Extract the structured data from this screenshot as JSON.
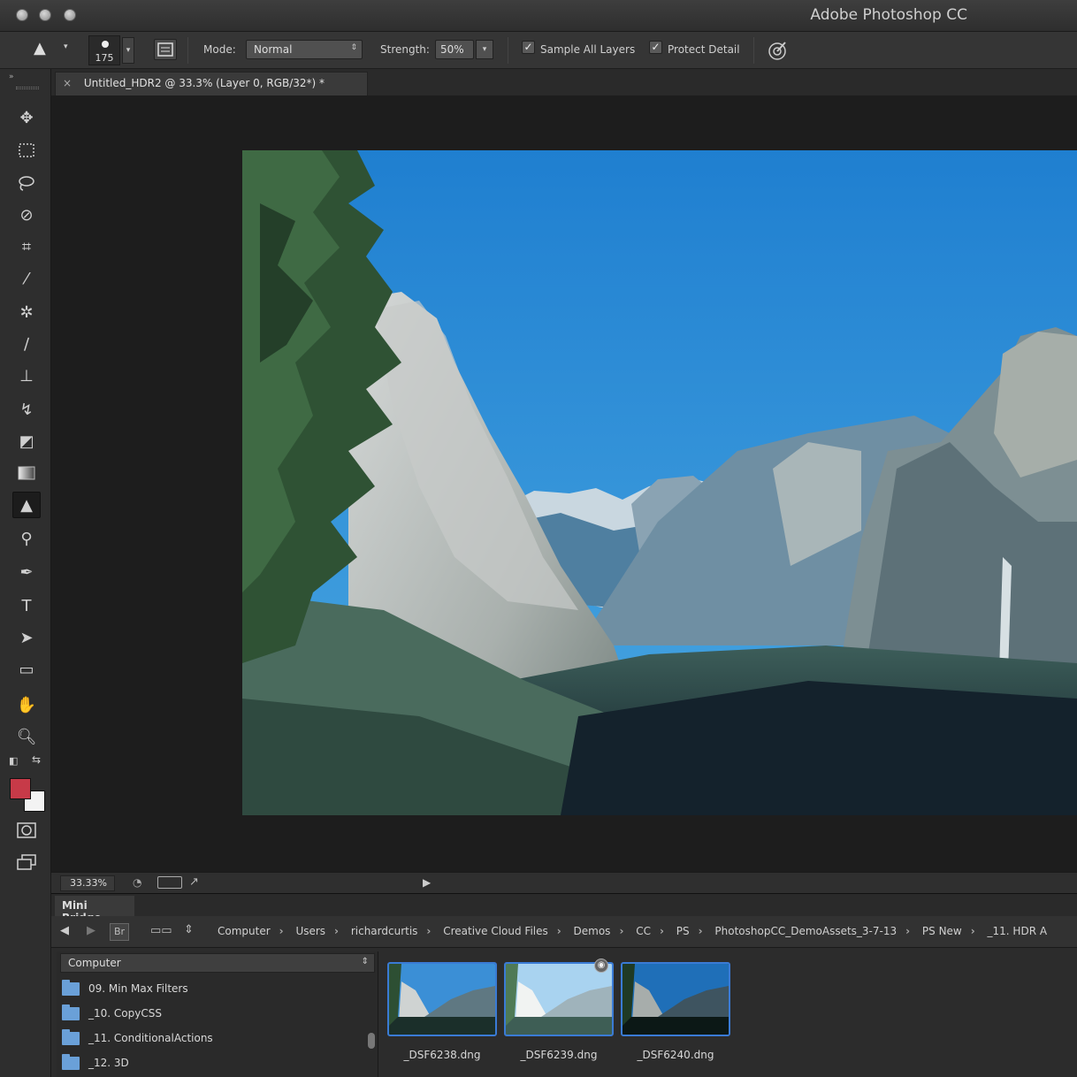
{
  "window": {
    "title": "Adobe Photoshop CC"
  },
  "options_bar": {
    "brush_size": "175",
    "mode_label": "Mode:",
    "mode_value": "Normal",
    "strength_label": "Strength:",
    "strength_value": "50%",
    "sample_all_layers_label": "Sample All Layers",
    "sample_all_layers_checked": true,
    "protect_detail_label": "Protect Detail",
    "protect_detail_checked": true
  },
  "document": {
    "tab_title": "Untitled_HDR2 @ 33.3% (Layer 0, RGB/32*) *",
    "zoom": "33.33%"
  },
  "colors": {
    "foreground": "#c73a48",
    "background": "#f3f3f3",
    "accent": "#3a7bd5"
  },
  "tools": [
    "move-tool-icon",
    "marquee-tool-icon",
    "lasso-tool-icon",
    "quick-selection-tool-icon",
    "crop-tool-icon",
    "eyedropper-tool-icon",
    "spot-healing-tool-icon",
    "brush-tool-icon",
    "clone-stamp-tool-icon",
    "history-brush-tool-icon",
    "eraser-tool-icon",
    "gradient-tool-icon",
    "sharpen-tool-icon",
    "dodge-tool-icon",
    "pen-tool-icon",
    "type-tool-icon",
    "path-selection-tool-icon",
    "rectangle-tool-icon",
    "hand-tool-icon",
    "zoom-tool-icon"
  ],
  "mini_bridge": {
    "title": "Mini Bridge",
    "bridge_button": "Br",
    "breadcrumbs": [
      "Computer",
      "Users",
      "richardcurtis",
      "Creative Cloud Files",
      "Demos",
      "CC",
      "PS",
      "PhotoshopCC_DemoAssets_3-7-13",
      "PS New",
      "_11. HDR A"
    ],
    "location": "Computer",
    "folders": [
      "09. Min Max Filters",
      "_10. CopyCSS",
      "_11. ConditionalActions",
      "_12. 3D"
    ],
    "files": [
      "_DSF6238.dng",
      "_DSF6239.dng",
      "_DSF6240.dng"
    ]
  }
}
